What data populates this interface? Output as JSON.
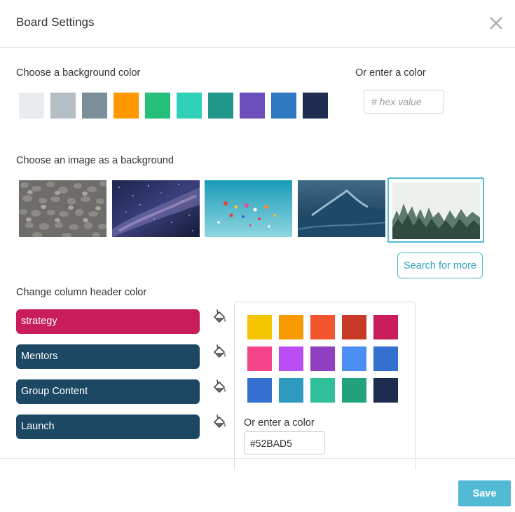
{
  "header": {
    "title": "Board Settings",
    "close_icon": "close-icon"
  },
  "background": {
    "label": "Choose a background color",
    "colors": [
      "#e8ecef",
      "#b3bfc5",
      "#7b8f9b",
      "#ff9800",
      "#26bf7a",
      "#2ed0b8",
      "#21968a",
      "#6c4fba",
      "#2e79bf",
      "#1e2c50"
    ],
    "custom_label": "Or enter a color",
    "custom_placeholder": "# hex value"
  },
  "images": {
    "label": "Choose an image as a background",
    "items": [
      "pebbles",
      "milky-way",
      "hot-air-balloons",
      "ocean-wave",
      "misty-forest"
    ],
    "selected": "misty-forest",
    "search_more": "Search for more"
  },
  "columns": {
    "label": "Change column header color",
    "items": [
      {
        "name": "strategy",
        "color": "#c81c5b"
      },
      {
        "name": "Mentors",
        "color": "#1c4864"
      },
      {
        "name": "Group Content",
        "color": "#1c4864"
      },
      {
        "name": "Launch",
        "color": "#1c4864"
      }
    ],
    "bucket_icon": "paint-bucket-icon"
  },
  "palette": {
    "colors": [
      "#f5c400",
      "#f59a00",
      "#f2542d",
      "#c93a26",
      "#c81c5b",
      "#f5448a",
      "#bb4df5",
      "#8f3fbf",
      "#4c8ef5",
      "#3470d0",
      "#3470d0",
      "#2f99bf",
      "#2fbf9a",
      "#22a37e",
      "#1e2c50"
    ],
    "custom_label": "Or enter a color",
    "custom_value": "#52BAD5"
  },
  "footer": {
    "save_label": "Save"
  }
}
